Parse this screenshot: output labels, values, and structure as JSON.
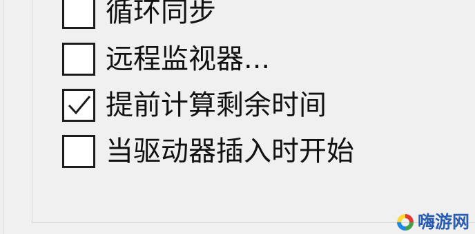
{
  "options": [
    {
      "label": "循环同步",
      "checked": false
    },
    {
      "label": "远程监视器...",
      "checked": false
    },
    {
      "label": "提前计算剩余时间",
      "checked": true
    },
    {
      "label": "当驱动器插入时开始",
      "checked": false
    }
  ],
  "watermark": {
    "text": "嗨游网",
    "icon": "swirl-logo-icon",
    "text_color": "#2a5db0"
  },
  "colors": {
    "background": "#f0f0f0",
    "checkbox_border": "#1c1c1c",
    "text": "#111111"
  }
}
